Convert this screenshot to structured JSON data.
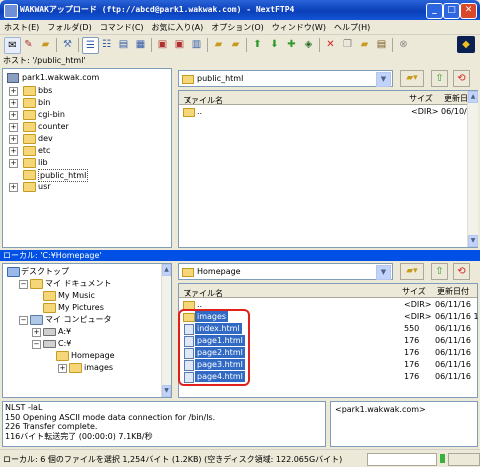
{
  "window": {
    "title": "WAKWAKアップロード (ftp://abcd@park1.wakwak.com) - NextFTP4",
    "min": "_",
    "max": "□",
    "close": "✕"
  },
  "menu": [
    "ホスト(E)",
    "フォルダ(D)",
    "コマンド(C)",
    "お気に入り(A)",
    "オプション(O)",
    "ウィンドウ(W)",
    "ヘルプ(H)"
  ],
  "toolbar": {
    "icons": [
      "connect-icon",
      "edit-icon",
      "open-folder-icon",
      "settings-icon",
      "list-icon",
      "detail-icon",
      "view-icon",
      "grid-icon",
      "upload-icon",
      "download-icon",
      "refresh-icon",
      "sort-icon",
      "up-arrow-icon",
      "down-arrow-icon",
      "add-icon",
      "sync-icon",
      "delete-icon",
      "copy-icon",
      "new-folder-icon",
      "rename-icon",
      "stop-icon",
      "logo-icon"
    ]
  },
  "host": {
    "path_line": "ホスト: '/public_html'",
    "tree_root": "park1.wakwak.com",
    "tree": [
      {
        "name": "bbs",
        "expand": "+"
      },
      {
        "name": "bin",
        "expand": "+"
      },
      {
        "name": "cgi-bin",
        "expand": "+"
      },
      {
        "name": "counter",
        "expand": "+"
      },
      {
        "name": "dev",
        "expand": "+"
      },
      {
        "name": "etc",
        "expand": "+"
      },
      {
        "name": "lib",
        "expand": "+"
      },
      {
        "name": "public_html",
        "expand": ""
      },
      {
        "name": "usr",
        "expand": "+"
      }
    ],
    "combo": "public_html",
    "columns": {
      "name": "ファイル名",
      "sort": "く",
      "size": "サイズ",
      "date": "更新日付"
    },
    "files": [
      {
        "name": "..",
        "size": "<DIR>",
        "date": "06/10/0"
      }
    ]
  },
  "local": {
    "path_line": "ローカル: 'C:¥Homepage'",
    "tree": [
      {
        "name": "デスクトップ",
        "level": 0,
        "expand": ""
      },
      {
        "name": "マイ ドキュメント",
        "level": 1,
        "expand": "−"
      },
      {
        "name": "My Music",
        "level": 2,
        "expand": ""
      },
      {
        "name": "My Pictures",
        "level": 2,
        "expand": ""
      },
      {
        "name": "マイ コンピュータ",
        "level": 1,
        "expand": "−"
      },
      {
        "name": "A:¥",
        "level": 2,
        "expand": "+"
      },
      {
        "name": "C:¥",
        "level": 2,
        "expand": "−"
      },
      {
        "name": "Homepage",
        "level": 3,
        "expand": ""
      },
      {
        "name": "images",
        "level": 4,
        "expand": "+"
      }
    ],
    "combo": "Homepage",
    "columns": {
      "name": "ファイル名",
      "sort": "く",
      "size": "サイズ",
      "date": "更新日付"
    },
    "files": [
      {
        "name": "..",
        "size": "<DIR>",
        "date": "06/11/16",
        "selected": false
      },
      {
        "name": "images",
        "size": "<DIR>",
        "date": "06/11/16 1",
        "selected": true
      },
      {
        "name": "index.html",
        "size": "550",
        "date": "06/11/16",
        "selected": true
      },
      {
        "name": "page1.html",
        "size": "176",
        "date": "06/11/16",
        "selected": true
      },
      {
        "name": "page2.html",
        "size": "176",
        "date": "06/11/16",
        "selected": true
      },
      {
        "name": "page3.html",
        "size": "176",
        "date": "06/11/16",
        "selected": true
      },
      {
        "name": "page4.html",
        "size": "176",
        "date": "06/11/16",
        "selected": true
      }
    ]
  },
  "log": [
    "NLST -laL",
    "150 Opening ASCII mode data connection for /bin/ls.",
    "226 Transfer complete.",
    "116バイト転送完了 (00:00:0) 7.1KB/秒"
  ],
  "host_box": "<park1.wakwak.com>",
  "status": "ローカル: 6 個のファイルを選択  1,254バイト (1.2KB)  (空きディスク領域: 122.065Gバイト)",
  "colors": {
    "titlebar": "#0a3fb8",
    "selection": "#316ac5",
    "highlight_box": "#e0201a",
    "path_bar": "#0050e6"
  }
}
